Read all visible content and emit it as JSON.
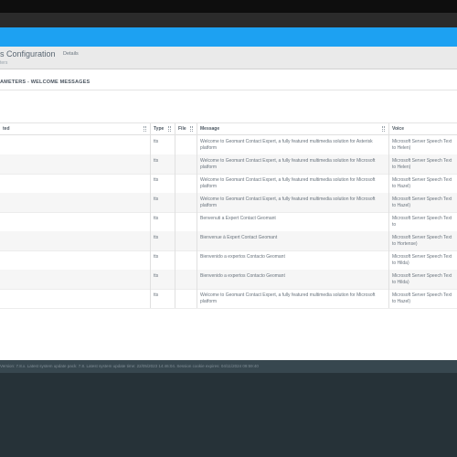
{
  "header": {
    "title": "s Configuration",
    "subtitle": "ters",
    "tab_details": "Details"
  },
  "section": {
    "title": "AMETERS - WELCOME MESSAGES"
  },
  "table": {
    "columns": [
      "ted",
      "Type",
      "File",
      "Message",
      "Voice"
    ],
    "rows": [
      {
        "type": "tts",
        "message": "Welcome to Geomant Contact Expert, a fully featured multimedia solution for Asterisk platform",
        "voice": "Microsoft Server Speech Text to Helen)"
      },
      {
        "type": "tts",
        "message": "Welcome to Geomant Contact Expert, a fully featured multimedia solution for Microsoft platform",
        "voice": "Microsoft Server Speech Text to Helen)"
      },
      {
        "type": "tts",
        "message": "Welcome to Geomant Contact Expert, a fully featured multimedia solution for Microsoft platform",
        "voice": "Microsoft Server Speech Text to Hazel)"
      },
      {
        "type": "tts",
        "message": "Welcome to Geomant Contact Expert, a fully featured multimedia solution for Microsoft platform",
        "voice": "Microsoft Server Speech Text to Hazel)"
      },
      {
        "type": "tts",
        "message": "Benvenuti a Expert Contact Geomant",
        "voice": "Microsoft Server Speech Text to"
      },
      {
        "type": "tts",
        "message": "Bienvenue à Expert Contact Geomant",
        "voice": "Microsoft Server Speech Text to Hortense)"
      },
      {
        "type": "tts",
        "message": "Bienvenido a expertos Contacto Geomant",
        "voice": "Microsoft Server Speech Text to Hilda)"
      },
      {
        "type": "tts",
        "message": "Bienvenido a expertos Contacto Geomant",
        "voice": "Microsoft Server Speech Text to Hilda)"
      },
      {
        "type": "tts",
        "message": "Welcome to Geomant Contact Expert, a fully featured multimedia solution for Microsoft platform",
        "voice": "Microsoft Server Speech Text to Hazel)"
      }
    ]
  },
  "footer": {
    "text": "Version: 7.8.x. Latest system update pack: 7.8. Latest system update time: 22/05/2023 14:46:04. Session cookie expires: 04/11/2024 09:59:40"
  }
}
